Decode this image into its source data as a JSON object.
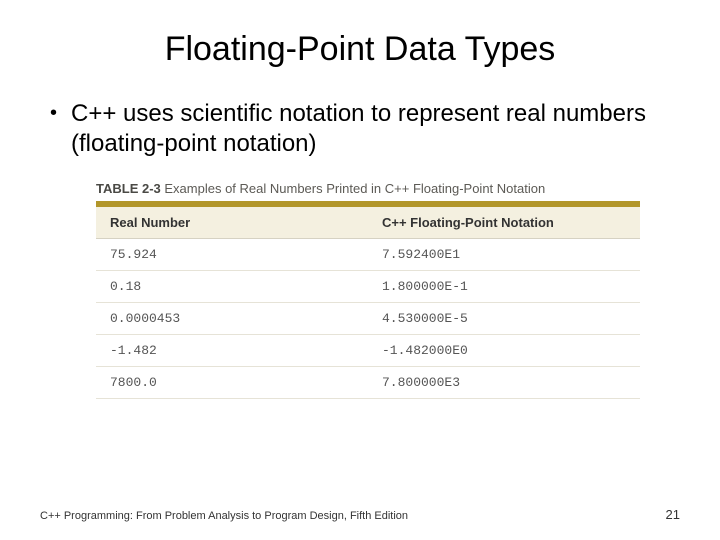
{
  "title": "Floating-Point Data Types",
  "bullet": "C++ uses scientific notation to represent real numbers (floating-point notation)",
  "table": {
    "caption_label": "TABLE 2-3",
    "caption_text": "Examples of Real Numbers Printed in C++ Floating-Point Notation",
    "head_col1": "Real Number",
    "head_col2": "C++ Floating-Point Notation",
    "rows": [
      {
        "real": "75.924",
        "fp": "7.592400E1"
      },
      {
        "real": "0.18",
        "fp": "1.800000E-1"
      },
      {
        "real": "0.0000453",
        "fp": "4.530000E-5"
      },
      {
        "real": "-1.482",
        "fp": "-1.482000E0"
      },
      {
        "real": "7800.0",
        "fp": "7.800000E3"
      }
    ]
  },
  "footer_text": "C++ Programming: From Problem Analysis to Program Design, Fifth Edition",
  "page_number": "21"
}
